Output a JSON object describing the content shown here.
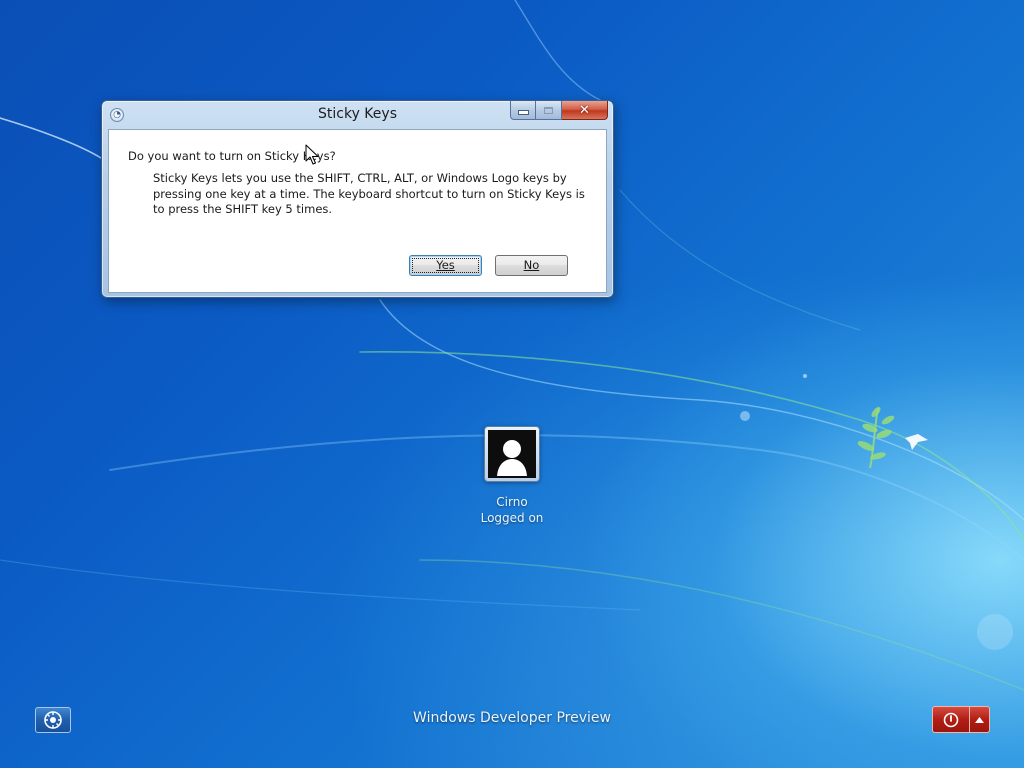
{
  "dialog": {
    "title": "Sticky Keys",
    "question": "Do you want to turn on Sticky Keys?",
    "description": "Sticky Keys lets you use the SHIFT, CTRL, ALT, or Windows Logo keys by pressing one key at a time. The keyboard shortcut to turn on Sticky Keys is to press the SHIFT key 5 times.",
    "buttons": {
      "yes_label": "Yes",
      "no_label": "No"
    },
    "caption_buttons": {
      "close_glyph": "✕"
    }
  },
  "user": {
    "name": "Cirno",
    "status": "Logged on"
  },
  "bottom_bar": {
    "brand": "Windows Developer Preview",
    "ease_of_access_icon": "ease-of-access-icon",
    "power_icon": "power-icon",
    "power_options_icon": "chevron-up-icon"
  },
  "colors": {
    "desktop_blue": "#0b5ac4",
    "power_red": "#b11e15",
    "close_red": "#c0391f"
  }
}
